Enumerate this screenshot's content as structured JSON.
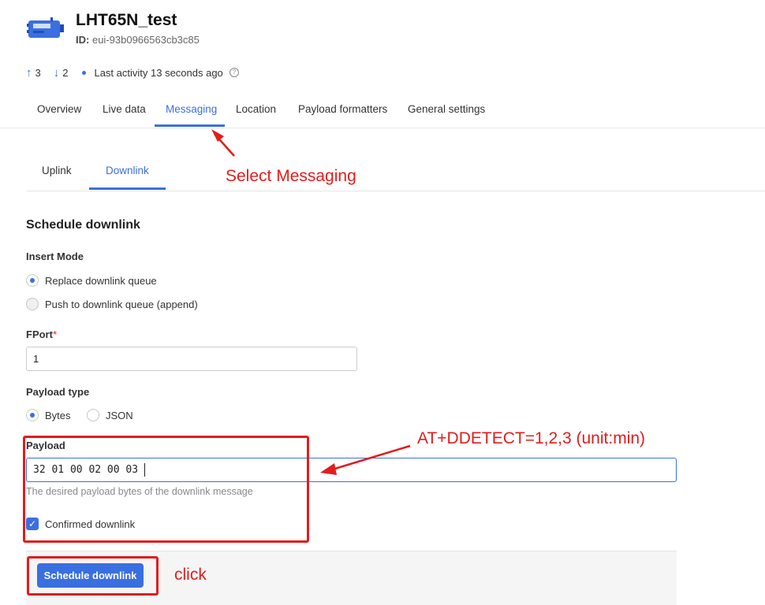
{
  "device": {
    "name": "LHT65N_test",
    "id_label": "ID:",
    "id_value": "eui-93b0966563cb3c85"
  },
  "stats": {
    "uplinks": "3",
    "downlinks": "2",
    "last_activity": "Last activity 13 seconds ago"
  },
  "tabs": [
    {
      "label": "Overview"
    },
    {
      "label": "Live data"
    },
    {
      "label": "Messaging"
    },
    {
      "label": "Location"
    },
    {
      "label": "Payload formatters"
    },
    {
      "label": "General settings"
    }
  ],
  "subtabs": [
    {
      "label": "Uplink"
    },
    {
      "label": "Downlink"
    }
  ],
  "form": {
    "title": "Schedule downlink",
    "insert_mode_label": "Insert Mode",
    "insert_modes": [
      {
        "label": "Replace downlink queue",
        "checked": true
      },
      {
        "label": "Push to downlink queue (append)",
        "checked": false
      }
    ],
    "fport_label": "FPort",
    "required_mark": "*",
    "fport_value": "1",
    "payload_type_label": "Payload type",
    "payload_types": [
      {
        "label": "Bytes",
        "checked": true
      },
      {
        "label": "JSON",
        "checked": false
      }
    ],
    "payload_label": "Payload",
    "payload_value": "32 01 00 02 00 03",
    "payload_hint": "The desired payload bytes of the downlink message",
    "confirmed_label": "Confirmed downlink",
    "confirmed_checked": true,
    "submit_label": "Schedule downlink"
  },
  "annotations": {
    "select_messaging": "Select Messaging",
    "payload_note": "AT+DDETECT=1,2,3 (unit:min)",
    "click": "click",
    "color": "#e31c1c"
  },
  "colors": {
    "accent": "#3a6fe0"
  }
}
